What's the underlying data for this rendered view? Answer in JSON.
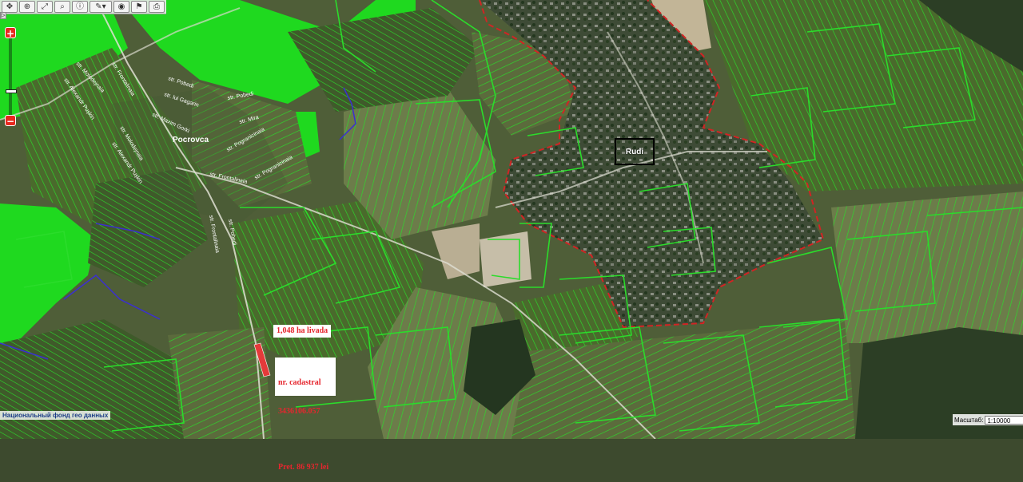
{
  "toolbar": {
    "buttons": [
      {
        "name": "pan-icon",
        "glyph": "✥"
      },
      {
        "name": "zoom-in-icon",
        "glyph": "⊕"
      },
      {
        "name": "full-extent-icon",
        "glyph": "⤢"
      },
      {
        "name": "binoculars-icon",
        "glyph": "⌕"
      },
      {
        "name": "info-icon",
        "glyph": "ⓘ"
      },
      {
        "name": "measure-icon",
        "glyph": "✎▾"
      },
      {
        "name": "target-icon",
        "glyph": "◉"
      },
      {
        "name": "flag-icon",
        "glyph": "⚑"
      },
      {
        "name": "print-icon",
        "glyph": "⎙"
      }
    ]
  },
  "zoom": {
    "plus": "+",
    "minus": "−",
    "level_fraction": 0.64
  },
  "left_tab": "▷",
  "places": {
    "pocrovca": "Pocrovca",
    "rudi": "Rudi"
  },
  "streets": [
    "str. Frontalinaia",
    "str. Pobedi",
    "str. lui Gagarin",
    "str. Pobedi",
    "str. Maxim Gorki",
    "str. Mira",
    "str. Alexandr Pușkin",
    "str. Molodejnaia",
    "str. Molodejnaia",
    "str. Alexandr Pușkin",
    "str. Frontalinaia",
    "str. Pogranicinaia",
    "str. Pogranicinaia",
    "str. Pobedi",
    "str. Frontalinaia"
  ],
  "annotations": {
    "area": "1,048 ha livada",
    "cadastral_label": "nr. cadastral",
    "cadastral_number": "3436106.057",
    "price": "Pret. 86 937 lei"
  },
  "attribution": "Национальный фонд гео данных",
  "scale": {
    "label": "Масштаб:",
    "value": "1:10000"
  },
  "colors": {
    "parcel_green": "#2bdc2b",
    "village_border": "#d12424",
    "label_red": "#e6262e",
    "stream": "#3b2fd0"
  }
}
